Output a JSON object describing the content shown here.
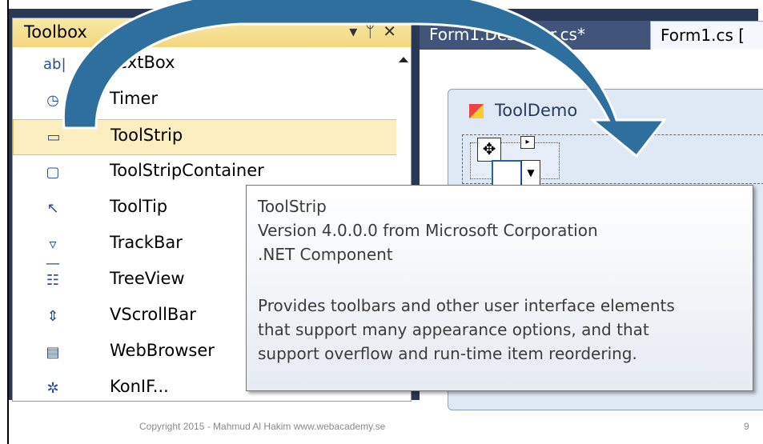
{
  "toolbox": {
    "title": "Toolbox",
    "controls": "▾ ᛘ ✕",
    "items": [
      {
        "label": "TextBox",
        "icon": "textbox-icon",
        "glyph": "ab|"
      },
      {
        "label": "Timer",
        "icon": "timer-icon",
        "glyph": "◷"
      },
      {
        "label": "ToolStrip",
        "icon": "toolstrip-icon",
        "glyph": "▭"
      },
      {
        "label": "ToolStripContainer",
        "icon": "toolstripcontainer-icon",
        "glyph": "▢"
      },
      {
        "label": "ToolTip",
        "icon": "tooltip-icon",
        "glyph": "↖"
      },
      {
        "label": "TrackBar",
        "icon": "trackbar-icon",
        "glyph": "▿—"
      },
      {
        "label": "TreeView",
        "icon": "treeview-icon",
        "glyph": "☷"
      },
      {
        "label": "VScrollBar",
        "icon": "vscrollbar-icon",
        "glyph": "⇕"
      },
      {
        "label": "WebBrowser",
        "icon": "webbrowser-icon",
        "glyph": "▤"
      },
      {
        "label": "KonIF...",
        "icon": "component-icon",
        "glyph": "✲"
      }
    ],
    "selected_index": 2
  },
  "tabs": [
    {
      "label": "Form1.Designer.cs*"
    },
    {
      "label": "Form1.cs ["
    }
  ],
  "designer": {
    "form_title": "ToolDemo"
  },
  "tooltip": {
    "lines": [
      "ToolStrip",
      "Version 4.0.0.0 from Microsoft Corporation",
      ".NET Component",
      "",
      "Provides toolbars and other user interface elements",
      "that support many appearance options, and that",
      "support overflow and run-time item reordering."
    ]
  },
  "footer": {
    "copyright": "Copyright 2015 - Mahmud Al Hakim www.webacademy.se",
    "page_number": "9"
  },
  "colors": {
    "ide_background": "#293955",
    "toolbox_header": "#f2d77e",
    "selected_item": "#fbeec0",
    "arrow": "#2e6f9e"
  }
}
